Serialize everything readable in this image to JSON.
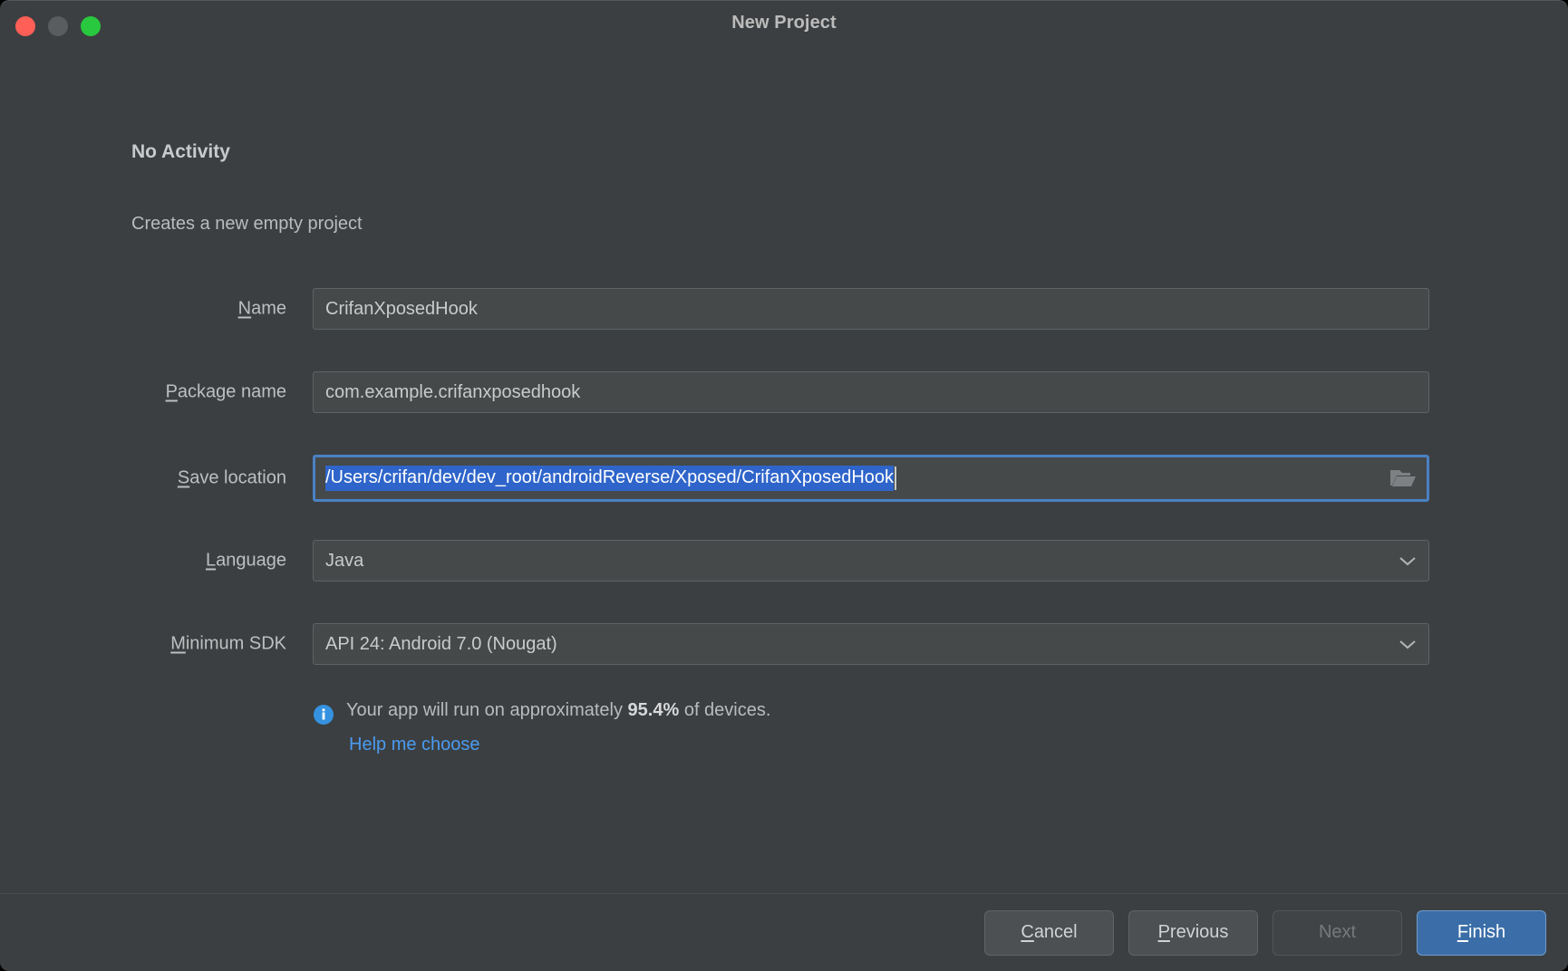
{
  "window": {
    "title": "New Project",
    "traffic_lights": [
      "close-light",
      "minimize-light",
      "zoom-light"
    ]
  },
  "header": {
    "section_title": "No Activity",
    "section_description": "Creates a new empty project"
  },
  "form": {
    "name": {
      "label_mnemonic": "N",
      "label_rest": "ame",
      "value": "CrifanXposedHook"
    },
    "package_name": {
      "label_mnemonic": "P",
      "label_rest": "ackage name",
      "value": "com.example.crifanxposedhook"
    },
    "save_location": {
      "label_mnemonic": "S",
      "label_rest": "ave location",
      "value": "/Users/crifan/dev/dev_root/androidReverse/Xposed/CrifanXposedHook",
      "browse_icon": "folder-icon",
      "selected": true,
      "focused": true
    },
    "language": {
      "label_mnemonic": "L",
      "label_rest": "anguage",
      "value": "Java",
      "arrow_icon": "chevron-down-icon"
    },
    "minimum_sdk": {
      "label_mnemonic": "M",
      "label_rest": "inimum SDK",
      "value": "API 24: Android 7.0 (Nougat)",
      "arrow_icon": "chevron-down-icon"
    }
  },
  "info": {
    "icon": "info-icon",
    "text_before": "Your app will run on approximately ",
    "percent": "95.4%",
    "text_after": " of devices.",
    "help_link": "Help me choose"
  },
  "footer": {
    "cancel": {
      "mnemonic": "C",
      "rest": "ancel"
    },
    "previous": {
      "mnemonic": "P",
      "rest": "revious"
    },
    "next": {
      "label": "Next",
      "disabled": true
    },
    "finish": {
      "mnemonic": "F",
      "rest": "inish",
      "is_default": true
    }
  },
  "colors": {
    "background": "#3c3f41",
    "field_background": "#45494a",
    "focus_border": "#4a81c4",
    "selection": "#2f65ca",
    "link": "#4a9bf0",
    "default_button": "#3b6ea8"
  }
}
